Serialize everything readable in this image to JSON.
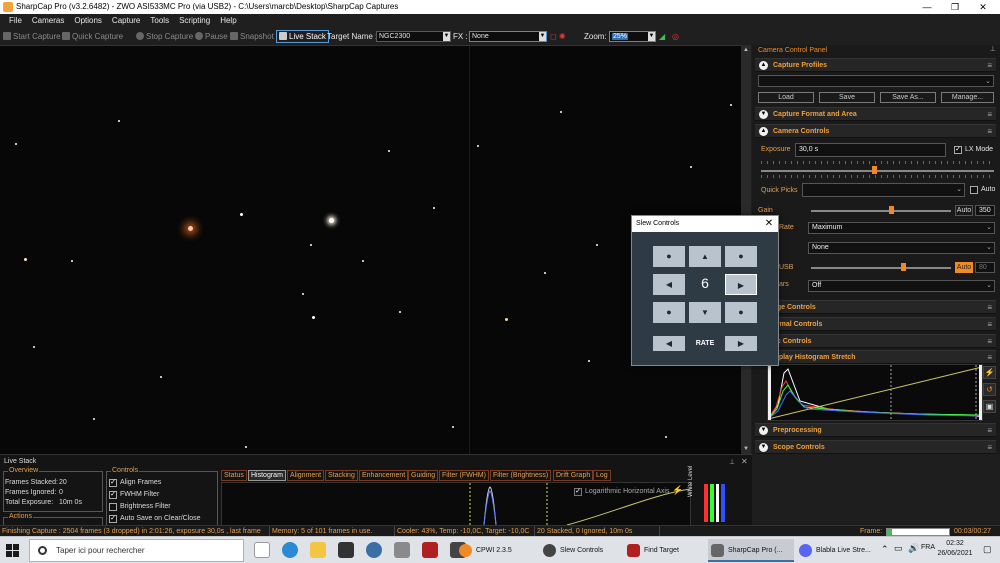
{
  "window": {
    "title": "SharpCap Pro (v3.2.6482) - ZWO ASI533MC Pro (via USB2) - C:\\Users\\marcb\\Desktop\\SharpCap Captures",
    "min": "—",
    "max": "❐",
    "close": "✕"
  },
  "menu": [
    "File",
    "Cameras",
    "Options",
    "Capture",
    "Tools",
    "Scripting",
    "Help"
  ],
  "toolbar": {
    "start_capture": "Start Capture",
    "quick_capture": "Quick Capture",
    "stop_capture": "Stop Capture",
    "pause": "Pause",
    "snapshot": "Snapshot",
    "live_stack": "Live Stack",
    "target_label": "Target Name :",
    "target_value": "NGC2300",
    "fx_label": "FX :",
    "fx_value": "None",
    "zoom_label": "Zoom:",
    "zoom_value": "25%"
  },
  "right_panel": {
    "title": "Camera Control Panel",
    "capture_profiles": "Capture Profiles",
    "load": "Load",
    "save": "Save",
    "save_as": "Save As...",
    "manage": "Manage...",
    "capture_format": "Capture Format and Area",
    "camera_controls": "Camera Controls",
    "exposure_label": "Exposure",
    "exposure_value": "30,0 s",
    "lx_mode": "LX Mode",
    "quick_picks": "Quick Picks",
    "auto": "Auto",
    "gain_label": "Gain",
    "gain_auto": "Auto",
    "gain_value": "350",
    "frame_rate_label": "Rate",
    "frame_rate_value": "Maximum",
    "none_value": "None",
    "usb_label": "USB",
    "usb_auto": "Auto",
    "usb_value": "80",
    "ars_label": "ars",
    "ars_value": "Off",
    "image_controls": "age Controls",
    "thermal_controls": "ermal Controls",
    "misc_controls": "sc Controls",
    "display_histogram": "isplay Histogram Stretch",
    "preprocessing": "Preprocessing",
    "scope_controls": "Scope Controls"
  },
  "slew": {
    "title": "Slew Controls",
    "close": "✕",
    "up": "▲",
    "down": "▼",
    "left": "◀",
    "right": "▶",
    "dot": "●",
    "rate_value": "6",
    "rate_label": "RATE",
    "rate_left": "◀",
    "rate_right": "▶"
  },
  "live_stack": {
    "title": "Live Stack",
    "overview_label": "Overview",
    "frames_stacked_label": "Frames Stacked:",
    "frames_stacked": "20",
    "frames_ignored_label": "Frames Ignored:",
    "frames_ignored": "0",
    "total_exposure_label": "Total Exposure:",
    "total_exposure": "10m 0s",
    "actions_label": "Actions",
    "controls_label": "Controls",
    "align_frames": "Align Frames",
    "fwhm_filter": "FWHM Filter",
    "brightness_filter": "Brightness Filter",
    "auto_save": "Auto Save on Clear/Close",
    "tabs": [
      "Status",
      "Histogram",
      "Alignment",
      "Stacking",
      "Enhancement",
      "Guiding",
      "Filter (FWHM)",
      "Filter (Brightness)",
      "Drift Graph",
      "Log"
    ],
    "log_axis": "Logarithmic Horizontal Axis",
    "white_level": "White Level"
  },
  "status_bar": {
    "capture": "Finishing Capture : 2504 frames (3 dropped) in 2:01:26, exposure 30,0s , last frame",
    "memory": "Memory: 5 of 101 frames in use.",
    "cooler": "Cooler: 43%, Temp: -10,0C, Target: -10,0C",
    "stacked": "20 Stacked, 0 Ignored, 10m 0s",
    "frame_label": "Frame:",
    "frame_time": "00:03/00:27"
  },
  "taskbar": {
    "search_placeholder": "Taper ici pour rechercher",
    "apps": [
      "CPWI 2.3.5",
      "Slew Controls",
      "Find Target",
      "SharpCap Pro (...",
      "Blabla Live Stre..."
    ],
    "time": "02:32",
    "date": "26/06/2021"
  },
  "colors": {
    "accent_orange": "#f08a24",
    "selection_blue": "#2f6fb8",
    "slew_bg": "#2e3a44"
  }
}
